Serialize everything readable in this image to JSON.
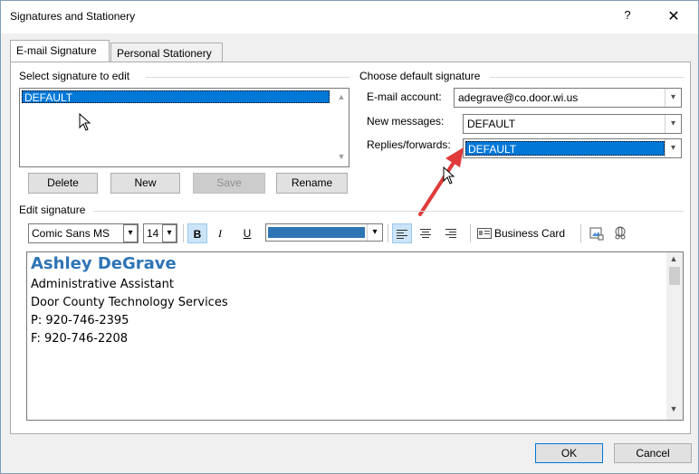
{
  "window": {
    "title": "Signatures and Stationery",
    "help_label": "?",
    "close_label": "✕"
  },
  "tabs": [
    {
      "label": "E-mail Signature",
      "active": true
    },
    {
      "label": "Personal Stationery",
      "active": false
    }
  ],
  "select_signature": {
    "label": "Select signature to edit",
    "items": [
      "DEFAULT"
    ],
    "buttons": {
      "delete": "Delete",
      "new": "New",
      "save": "Save",
      "rename": "Rename"
    }
  },
  "default_signature": {
    "label": "Choose default signature",
    "email_account_label": "E-mail account:",
    "email_account_value": "adegrave@co.door.wi.us",
    "new_messages_label": "New messages:",
    "new_messages_value": "DEFAULT",
    "replies_label": "Replies/forwards:",
    "replies_value": "DEFAULT"
  },
  "edit_signature": {
    "label": "Edit signature",
    "font_name": "Comic Sans MS",
    "font_size": "14",
    "bold_label": "B",
    "italic_label": "I",
    "underline_label": "U",
    "font_color": "#2e75b6",
    "business_card_label": "Business Card",
    "lines": {
      "name": "Ashley DeGrave",
      "title": "Administrative Assistant",
      "org": "Door County Technology Services",
      "phone": "P: 920-746-2395",
      "fax": "F: 920-746-2208"
    }
  },
  "footer": {
    "ok": "OK",
    "cancel": "Cancel"
  },
  "colors": {
    "selection": "#0078d7",
    "signature_name": "#2e75b6",
    "annotation_arrow": "#e03a3a"
  }
}
